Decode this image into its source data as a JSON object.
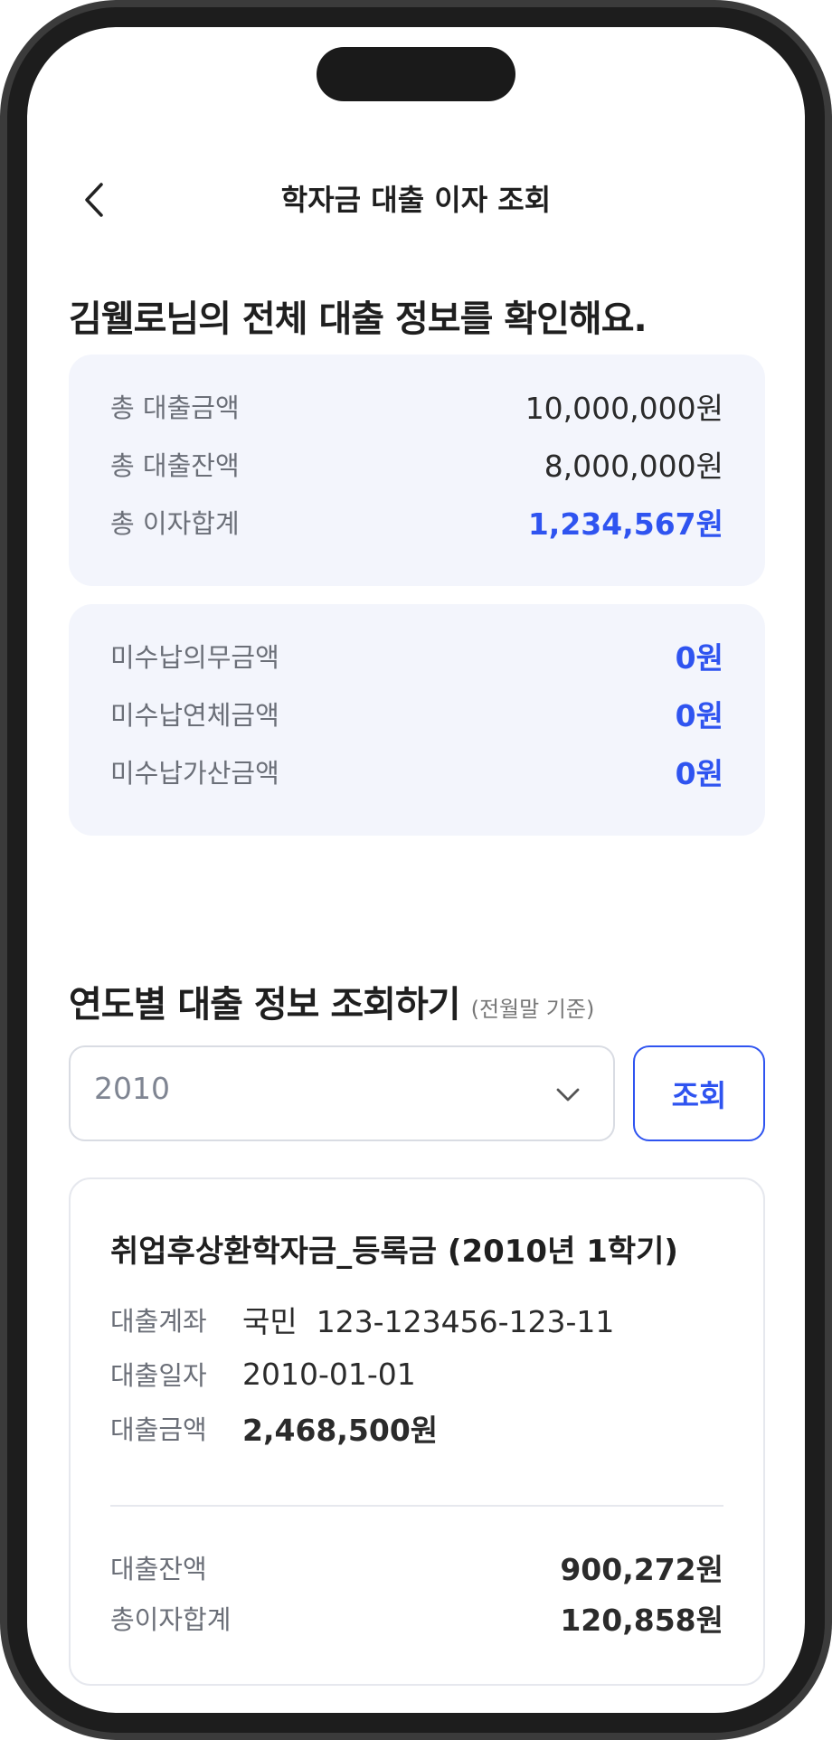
{
  "header": {
    "title": "학자금 대출 이자 조회"
  },
  "headline": "김웰로님의 전체 대출 정보를 확인해요.",
  "summary": {
    "rows": [
      {
        "label": "총 대출금액",
        "value": "10,000,000원"
      },
      {
        "label": "총 대출잔액",
        "value": "8,000,000원"
      },
      {
        "label": "총 이자합계",
        "value": "1,234,567원"
      }
    ]
  },
  "unpaid": {
    "rows": [
      {
        "label": "미수납의무금액",
        "value": "0원"
      },
      {
        "label": "미수납연체금액",
        "value": "0원"
      },
      {
        "label": "미수납가산금액",
        "value": "0원"
      }
    ]
  },
  "yearly": {
    "title": "연도별 대출 정보 조회하기",
    "subtitle": "(전월말 기준)",
    "select_value": "2010",
    "query_label": "조회"
  },
  "loan": {
    "title": "취업후상환학자금_등록금 (2010년 1학기)",
    "account_label": "대출계좌",
    "account_value": "국민  123-123456-123-11",
    "date_label": "대출일자",
    "date_value": "2010-01-01",
    "amount_label": "대출금액",
    "amount_value": "2,468,500원",
    "balance_label": "대출잔액",
    "balance_value": "900,272원",
    "interest_label": "총이자합계",
    "interest_value": "120,858원"
  },
  "colors": {
    "accent": "#2f54f0",
    "card_bg": "#f3f5fc"
  },
  "icons": {
    "back": "chevron-left-icon",
    "dropdown": "chevron-down-icon"
  }
}
